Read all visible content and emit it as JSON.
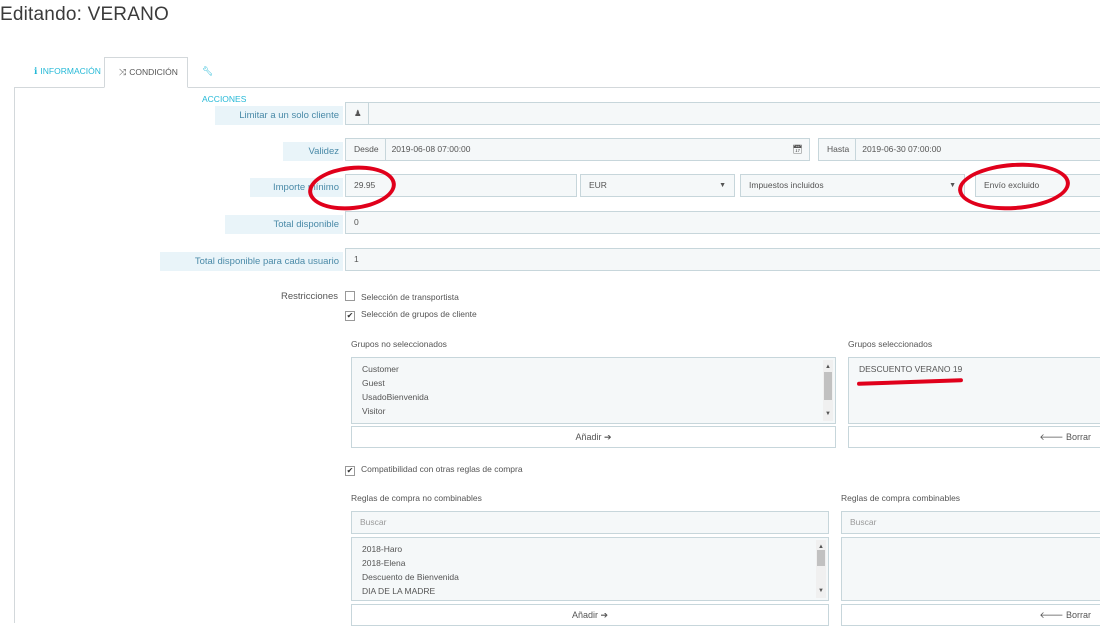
{
  "title": "Editando: VERANO",
  "tabs": [
    {
      "label": "INFORMACIÓN",
      "icon": "info-icon"
    },
    {
      "label": "CONDICIÓN",
      "icon": "shuffle-icon"
    },
    {
      "label": "ACCIONES",
      "icon": "wrench-icon"
    }
  ],
  "form": {
    "limit_customer": {
      "label": "Limitar a un solo cliente",
      "value": "",
      "icon": "user-icon"
    },
    "validity": {
      "label": "Validez",
      "from_addon": "Desde",
      "from_value": "2019-06-08 07:00:00",
      "to_addon": "Hasta",
      "to_value": "2019-06-30 07:00:00",
      "icon": "calendar-icon"
    },
    "min_amount": {
      "label": "Importe mínimo",
      "value": "29.95",
      "currency": "EUR",
      "tax": "Impuestos incluidos",
      "shipping": "Envío excluido"
    },
    "total_available": {
      "label": "Total disponible",
      "value": "0"
    },
    "total_per_user": {
      "label": "Total disponible para cada usuario",
      "value": "1"
    },
    "restrictions": {
      "label": "Restricciones",
      "carrier": {
        "label": "Selección de transportista",
        "checked": false
      },
      "groups": {
        "label": "Selección de grupos de cliente",
        "checked": true
      },
      "compat": {
        "label": "Compatibilidad con otras reglas de compra",
        "checked": true
      }
    },
    "groups_unselected": {
      "label": "Grupos no seleccionados",
      "items": [
        "Customer",
        "Guest",
        "UsadoBienvenida",
        "Visitor"
      ],
      "add_button": "Añadir ➔"
    },
    "groups_selected": {
      "label": "Grupos seleccionados",
      "items": [
        "DESCUENTO VERANO 19"
      ],
      "remove_button": "🡐 Borrar"
    },
    "rules_noncombinable": {
      "label": "Reglas de compra no combinables",
      "search_placeholder": "Buscar",
      "items": [
        "2018-Haro",
        "2018-Elena",
        "Descuento de Bienvenida",
        "DIA DE LA MADRE"
      ],
      "add_button": "Añadir ➔"
    },
    "rules_combinable": {
      "label": "Reglas de compra combinables",
      "search_placeholder": "Buscar",
      "remove_button": "🡐 Borrar"
    }
  },
  "colors": {
    "accent": "#25b9d7",
    "annotation": "#e0001b"
  }
}
